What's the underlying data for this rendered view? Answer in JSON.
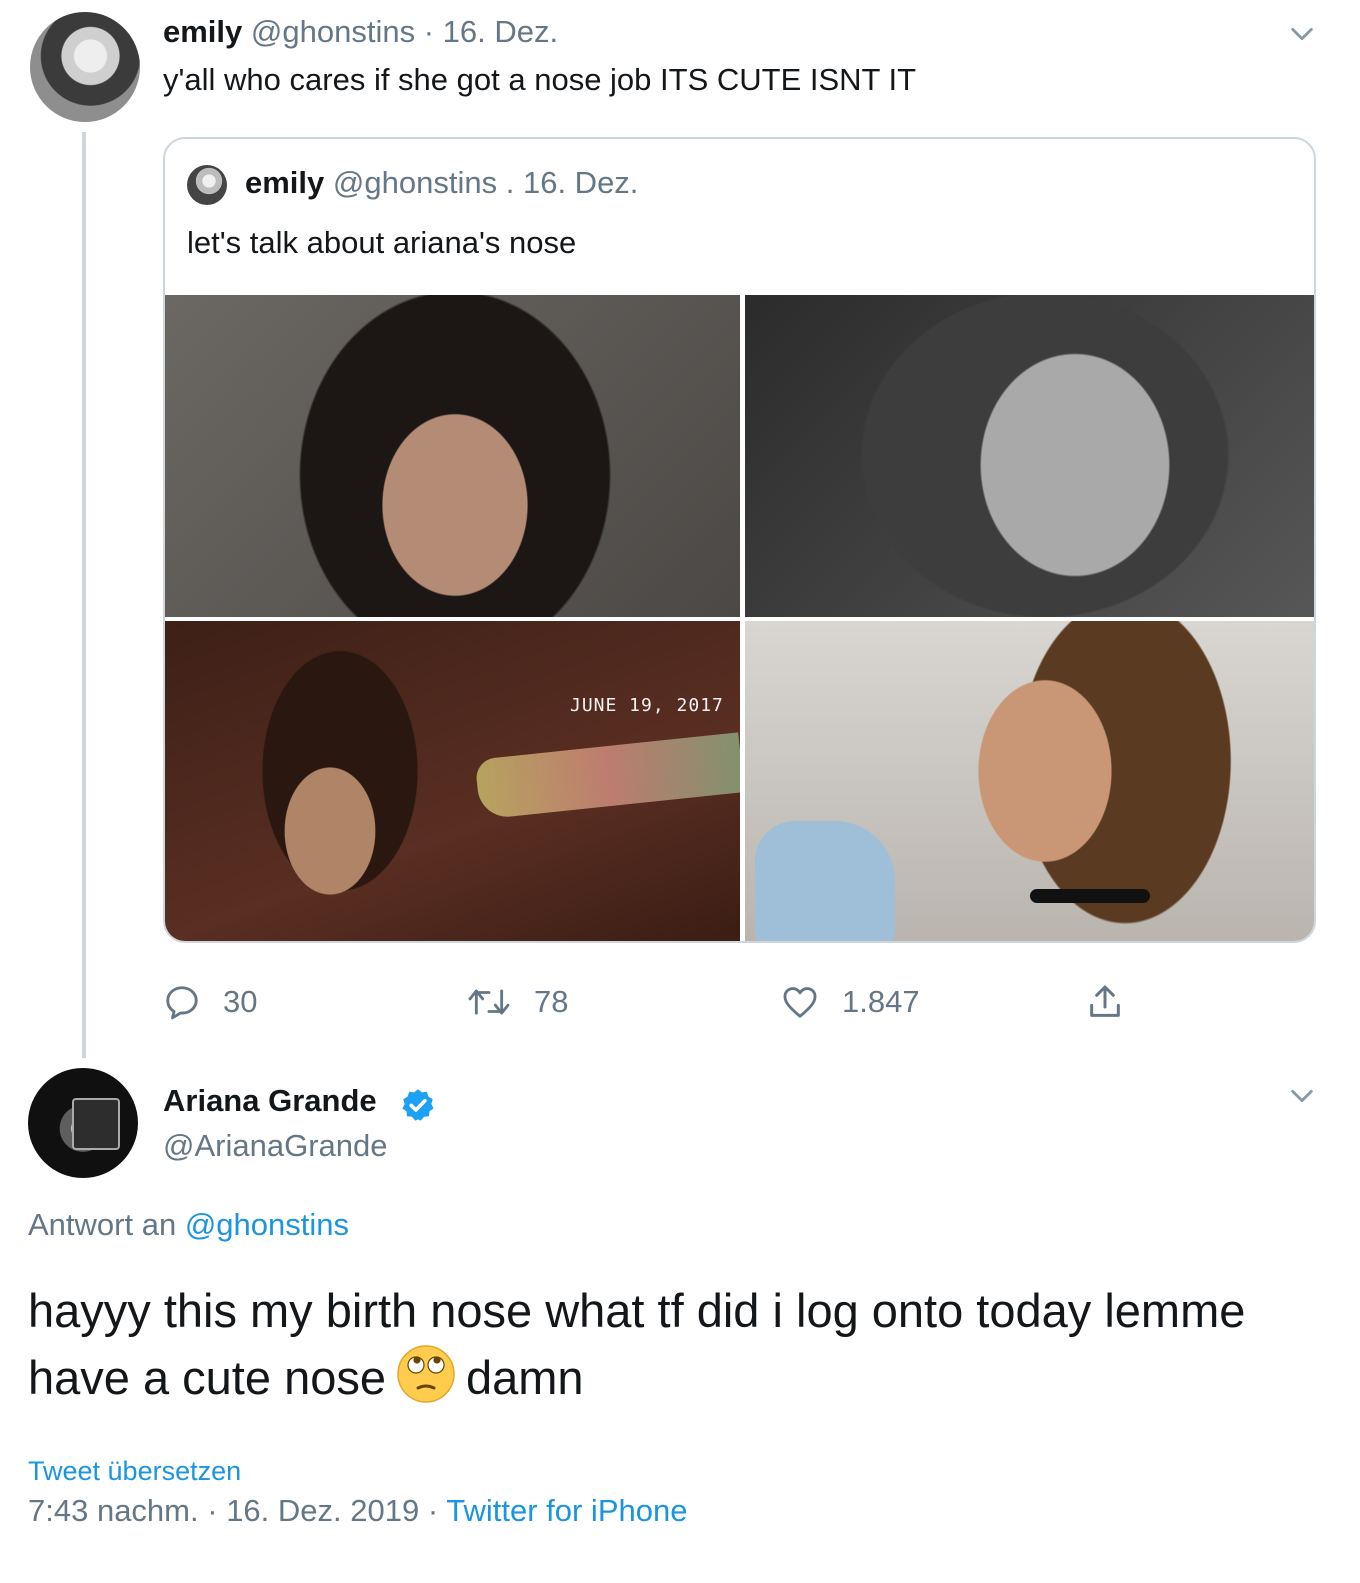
{
  "tweet": {
    "author_name": "emily",
    "author_handle": "@ghonstins",
    "separator": "·",
    "date": "16. Dez.",
    "text": "y'all who cares if she got a nose job ITS CUTE ISNT IT",
    "menu_icon": "chevron-down-icon",
    "quote": {
      "author_name": "emily",
      "author_handle": "@ghonstins",
      "separator": ".",
      "date": "16. Dez.",
      "text": "let's talk about ariana's nose",
      "photo_overlay_text": "JUNE 19, 2017"
    },
    "actions": {
      "reply_count": "30",
      "retweet_count": "78",
      "like_count": "1.847",
      "reply_icon": "speech-bubble-icon",
      "retweet_icon": "retweet-icon",
      "like_icon": "heart-icon",
      "share_icon": "share-icon"
    }
  },
  "reply": {
    "author_name": "Ariana Grande",
    "verified_icon": "verified-badge-icon",
    "author_handle": "@ArianaGrande",
    "reply_to_prefix": "Antwort an",
    "reply_to_handle": "@ghonstins",
    "text_before_emoji": "hayyy this my birth nose what tf did i log onto today lemme have a cute nose",
    "emoji": "face-with-rolling-eyes-emoji",
    "text_after_emoji": "damn",
    "translate_link": "Tweet übersetzen",
    "time": "7:43 nachm.",
    "date": "16. Dez. 2019",
    "separator": "·",
    "source": "Twitter for iPhone",
    "menu_icon": "chevron-down-icon"
  },
  "colors": {
    "link_blue": "#1b95e0",
    "secondary_gray": "#657786",
    "text_dark": "#14171a",
    "border": "#ccd6dd"
  }
}
